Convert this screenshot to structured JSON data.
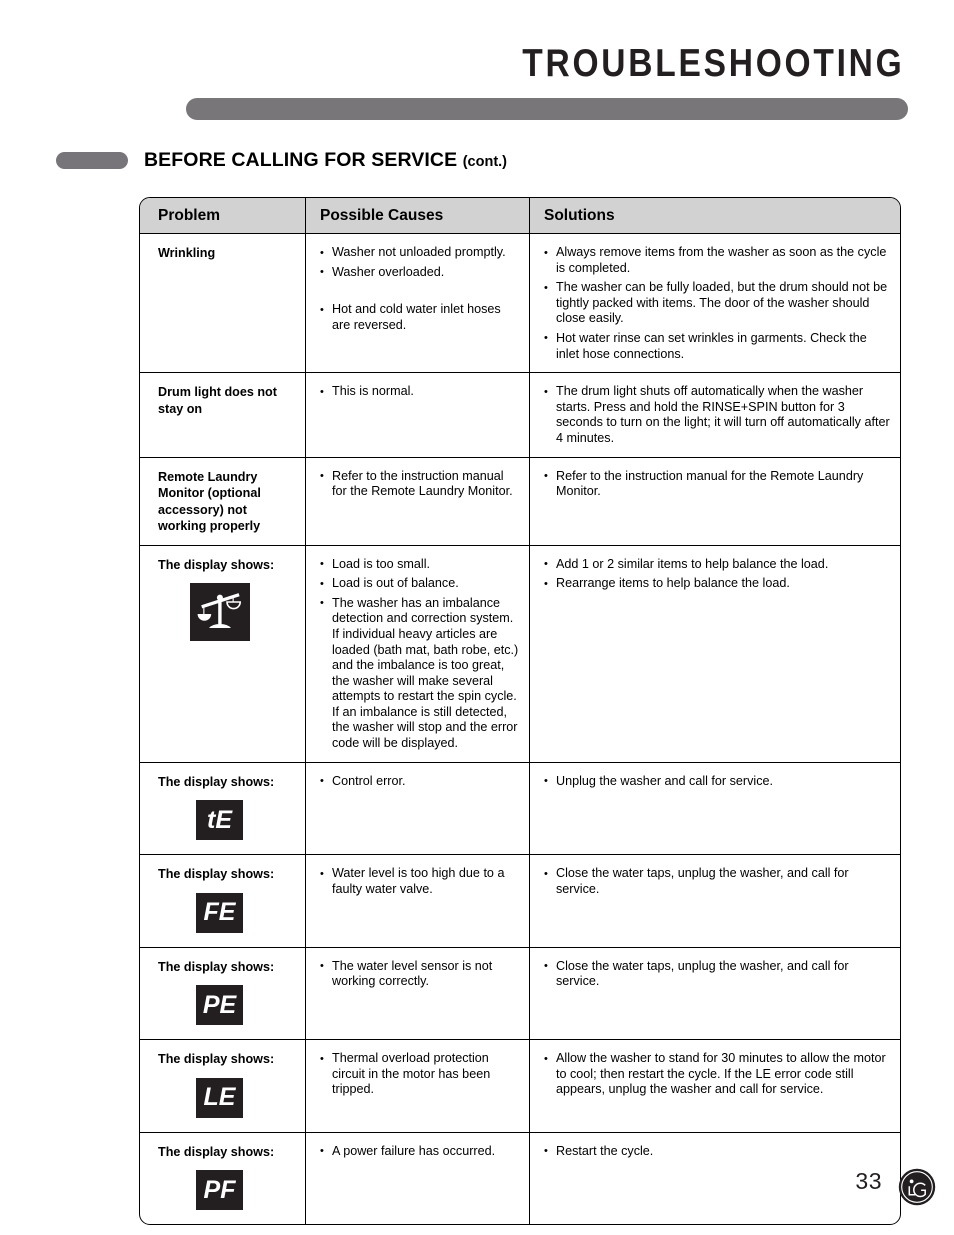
{
  "header": {
    "chapter_title": "TROUBLESHOOTING",
    "section_title": "BEFORE CALLING FOR SERVICE",
    "section_title_suffix": "(cont.)"
  },
  "table": {
    "columns": [
      "Problem",
      "Possible Causes",
      "Solutions"
    ],
    "rows": [
      {
        "problem": "Wrinkling",
        "icon": null,
        "causes": [
          {
            "text": "Washer not unloaded promptly."
          },
          {
            "text": "Washer overloaded."
          },
          {
            "text": "Hot and cold water inlet hoses are reversed.",
            "gap": true
          }
        ],
        "solutions": [
          {
            "text": "Always remove items from the washer as soon as the cycle is completed."
          },
          {
            "text": "The washer can be fully loaded, but the drum should not be tightly packed with items. The door of the washer should close easily."
          },
          {
            "text": "Hot water rinse can set wrinkles in garments. Check the inlet hose connections."
          }
        ]
      },
      {
        "problem": "Drum light does not stay on",
        "icon": null,
        "causes": [
          {
            "text": "This is normal."
          }
        ],
        "solutions": [
          {
            "text": "The drum light shuts off automatically when the washer starts. Press and hold the RINSE+SPIN button for 3 seconds to turn on the light; it will turn off automatically after 4 minutes."
          }
        ]
      },
      {
        "problem": "Remote Laundry Monitor (optional accessory) not working properly",
        "icon": null,
        "causes": [
          {
            "text": "Refer to the instruction manual for the Remote Laundry Monitor."
          }
        ],
        "solutions": [
          {
            "text": "Refer to the instruction manual for the Remote Laundry Monitor."
          }
        ]
      },
      {
        "problem": "The display shows:",
        "icon": "balance-scale-icon",
        "icon_code": null,
        "causes": [
          {
            "text": "Load is too small."
          },
          {
            "text": "Load is out of balance."
          },
          {
            "text": "The washer has an imbalance detection and correction system. If individual heavy articles are loaded (bath mat, bath robe, etc.) and the imbalance is too great, the washer will make several attempts to restart the spin cycle. If an imbalance is still detected, the washer will stop and the error code will be displayed."
          }
        ],
        "solutions": [
          {
            "text": "Add 1 or 2 similar items to help balance the load."
          },
          {
            "text": "Rearrange items to help balance the load."
          }
        ]
      },
      {
        "problem": "The display shows:",
        "icon": "error-code-chip",
        "icon_code": "tE",
        "causes": [
          {
            "text": "Control error."
          }
        ],
        "solutions": [
          {
            "text": "Unplug the washer and call for service."
          }
        ]
      },
      {
        "problem": "The display shows:",
        "icon": "error-code-chip",
        "icon_code": "FE",
        "causes": [
          {
            "text": "Water level is too high due to a faulty water valve."
          }
        ],
        "solutions": [
          {
            "text": "Close the water taps, unplug the washer, and call for service."
          }
        ]
      },
      {
        "problem": "The display shows:",
        "icon": "error-code-chip",
        "icon_code": "PE",
        "causes": [
          {
            "text": "The water level sensor is not working correctly."
          }
        ],
        "solutions": [
          {
            "text": "Close the water taps, unplug the washer, and call for service."
          }
        ]
      },
      {
        "problem": "The display shows:",
        "icon": "error-code-chip",
        "icon_code": "LE",
        "causes": [
          {
            "text": "Thermal overload protection circuit in the motor has been tripped."
          }
        ],
        "solutions": [
          {
            "text": "Allow the washer to stand for 30 minutes to allow the motor to cool; then restart the cycle. If the LE error code still appears, unplug the washer and call for service."
          }
        ]
      },
      {
        "problem": "The display shows:",
        "icon": "error-code-chip",
        "icon_code": "PF",
        "causes": [
          {
            "text": "A power failure has occurred."
          }
        ],
        "solutions": [
          {
            "text": "Restart the cycle."
          }
        ]
      }
    ]
  },
  "footer": {
    "page_number": "33",
    "logo": "lg-logo"
  },
  "colors": {
    "header_bar": "#787679",
    "section_pill": "#77757a",
    "table_header_bg": "#d2d2d2",
    "ink": "#231f20",
    "chip_bg": "#231f20"
  }
}
